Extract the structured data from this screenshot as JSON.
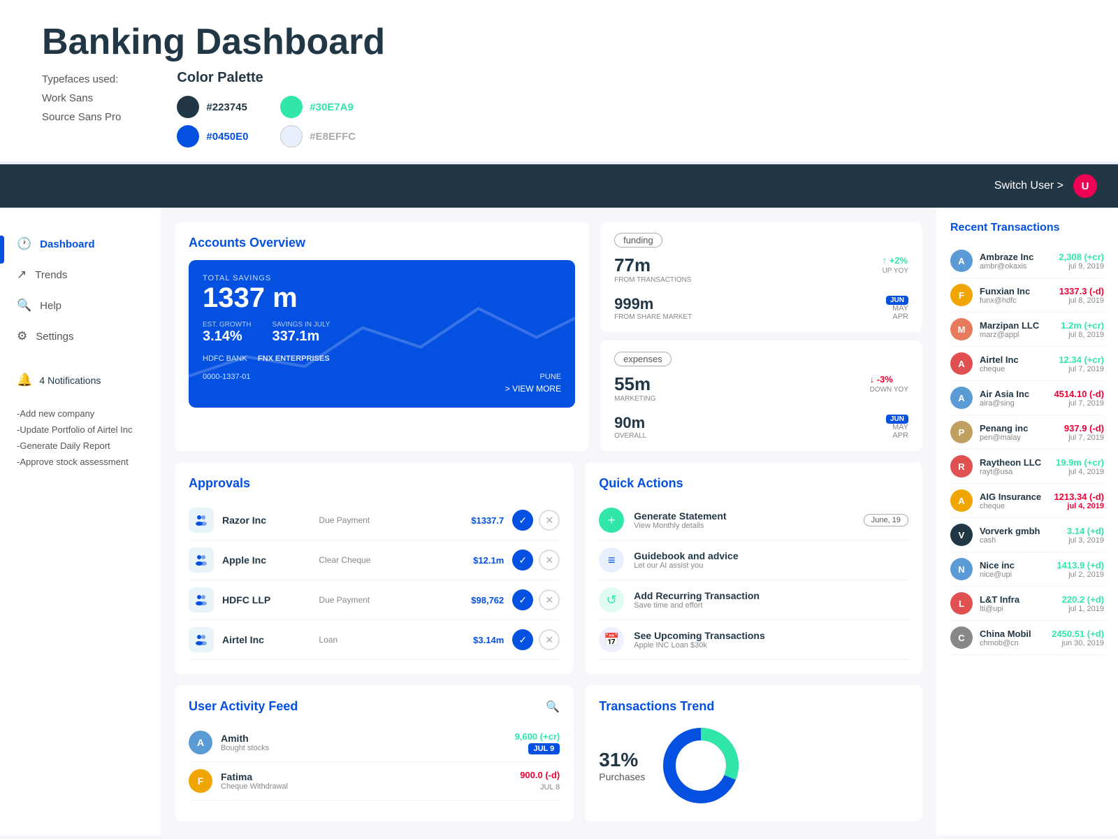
{
  "page": {
    "title": "Banking Dashboard",
    "typefaces": {
      "label": "Typefaces used:",
      "font1": "Work Sans",
      "font2": "Source Sans Pro"
    },
    "colorPalette": {
      "title": "Color Palette",
      "colors": [
        {
          "hex": "#223745",
          "dark": true
        },
        {
          "hex": "#30E7A9",
          "dark": false
        },
        {
          "hex": "#0450E0",
          "dark": false
        },
        {
          "hex": "#E8EFFC",
          "dark": false
        }
      ]
    }
  },
  "topbar": {
    "switchUser": "Switch User >",
    "avatarInitial": "U"
  },
  "sidebar": {
    "navItems": [
      {
        "label": "Dashboard",
        "icon": "🕐",
        "active": true
      },
      {
        "label": "Trends",
        "icon": "↗"
      },
      {
        "label": "Help",
        "icon": "🔍"
      },
      {
        "label": "Settings",
        "icon": "⚙"
      }
    ],
    "notifications": {
      "count": "4",
      "label": "4 Notifications"
    },
    "actions": [
      "-Add new company",
      "-Update Portfolio of Airtel Inc",
      "-Generate Daily Report",
      "-Approve stock assessment"
    ]
  },
  "accountsOverview": {
    "title": "Accounts Overview",
    "totalSavingsLabel": "TOTAL SAVINGS",
    "totalSavingsValue": "1337 m",
    "estGrowthLabel": "EST. GROWTH",
    "estGrowthValue": "3.14%",
    "savingsInJulyLabel": "SAVINGS IN JULY",
    "savingsInJulyValue": "337.1m",
    "bankName": "HDFC BANK",
    "companyName": "FNX ENTERPRISES",
    "accountNumber": "0000-1337-01",
    "location": "PUNE",
    "viewMore": "> VIEW MORE"
  },
  "funding": {
    "badge": "funding",
    "fromTransactionsLabel": "FROM TRANSACTIONS",
    "fromTransactionsValue": "77m",
    "changeLabel": "+2%",
    "changeDirection": "up",
    "upYoyLabel": "UP YOY",
    "fromShareMarketValue": "999m",
    "fromShareMarketLabel": "FROM SHARE MARKET",
    "junBadge": "JUN",
    "mayLabel": "MAY",
    "aprLabel": "APR"
  },
  "expenses": {
    "badge": "expenses",
    "marketingValue": "55m",
    "marketingLabel": "MARKETING",
    "changeLabel": "-3%",
    "changeDirection": "down",
    "downYoyLabel": "DOWN YOY",
    "overallValue": "90m",
    "overallLabel": "OVERALL",
    "junBadge": "JUN",
    "mayLabel": "MAY",
    "aprLabel": "APR"
  },
  "approvals": {
    "title": "Approvals",
    "rows": [
      {
        "company": "Razor Inc",
        "type": "Due Payment",
        "amount": "$1337.7"
      },
      {
        "company": "Apple Inc",
        "type": "Clear Cheque",
        "amount": "$12.1m"
      },
      {
        "company": "HDFC LLP",
        "type": "Due Payment",
        "amount": "$98,762"
      },
      {
        "company": "Airtel Inc",
        "type": "Loan",
        "amount": "$3.14m"
      }
    ]
  },
  "quickActions": {
    "title": "Quick Actions",
    "items": [
      {
        "icon": "+",
        "iconStyle": "green",
        "label": "Generate Statement",
        "sublabel": "View Monthly details",
        "badge": "June, 19"
      },
      {
        "icon": "≡",
        "iconStyle": "blue",
        "label": "Guidebook and advice",
        "sublabel": "Let our AI assist you",
        "badge": ""
      },
      {
        "icon": "↺",
        "iconStyle": "teal",
        "label": "Add Recurring Transaction",
        "sublabel": "Save time and effort",
        "badge": ""
      },
      {
        "icon": "📅",
        "iconStyle": "indigo",
        "label": "See Upcoming Transactions",
        "sublabel": "Apple INC   Loan   $30k",
        "badge": ""
      }
    ]
  },
  "recentTransactions": {
    "title": "Recent Transactions",
    "items": [
      {
        "initial": "A",
        "color": "#5b9bd5",
        "name": "Ambraze Inc",
        "email": "ambr@okaxis",
        "amount": "2,308 (+cr)",
        "positive": true,
        "date": "jul 9, 2019"
      },
      {
        "initial": "F",
        "color": "#f0a500",
        "name": "Funxian Inc",
        "email": "funx@hdfc",
        "amount": "1337.3 (-d)",
        "positive": false,
        "date": "jul 8, 2019"
      },
      {
        "initial": "M",
        "color": "#e87a5d",
        "name": "Marzipan LLC",
        "email": "marz@appl",
        "amount": "1.2m (+cr)",
        "positive": true,
        "date": "jul 8, 2019"
      },
      {
        "initial": "A",
        "color": "#e05050",
        "name": "Airtel Inc",
        "email": "cheque",
        "amount": "12.34 (+cr)",
        "positive": true,
        "date": "jul 7, 2019"
      },
      {
        "initial": "A",
        "color": "#5b9bd5",
        "name": "Air Asia Inc",
        "email": "aira@sing",
        "amount": "4514.10 (-d)",
        "positive": false,
        "date": "jul 7, 2019"
      },
      {
        "initial": "P",
        "color": "#c0a060",
        "name": "Penang inc",
        "email": "pen@malay",
        "amount": "937.9 (-d)",
        "positive": false,
        "date": "jul 7, 2019"
      },
      {
        "initial": "R",
        "color": "#e05050",
        "name": "Raytheon LLC",
        "email": "rayt@usa",
        "amount": "19.9m (+cr)",
        "positive": true,
        "date": "jul 4, 2019"
      },
      {
        "initial": "A",
        "color": "#f0a500",
        "name": "AIG Insurance",
        "email": "cheque",
        "amount": "1213.34 (-d)",
        "positive": false,
        "date": "jul 4, 2019",
        "dateRed": true
      },
      {
        "initial": "V",
        "color": "#223745",
        "name": "Vorverk gmbh",
        "email": "cash",
        "amount": "3.14 (+d)",
        "positive": true,
        "date": "jul 3, 2019"
      },
      {
        "initial": "N",
        "color": "#5b9bd5",
        "name": "Nice inc",
        "email": "nice@upi",
        "amount": "1413.9 (+d)",
        "positive": true,
        "date": "jul 2, 2019"
      },
      {
        "initial": "L",
        "color": "#e05050",
        "name": "L&T Infra",
        "email": "lti@upi",
        "amount": "220.2 (+d)",
        "positive": true,
        "date": "jul 1, 2019"
      },
      {
        "initial": "C",
        "color": "#888",
        "name": "China Mobil",
        "email": "chmob@cn",
        "amount": "2450.51 (+d)",
        "positive": true,
        "date": "jun 30, 2019"
      }
    ]
  },
  "userActivityFeed": {
    "title": "User Activity Feed",
    "searchIcon": "🔍",
    "items": [
      {
        "initial": "A",
        "color": "#5b9bd5",
        "name": "Amith",
        "action": "Bought stocks",
        "amount": "9,600 (+cr)",
        "positive": true,
        "date": "JUL 9",
        "dateBadge": true
      },
      {
        "initial": "F",
        "color": "#f0a500",
        "name": "Fatima",
        "action": "Cheque Withdrawal",
        "amount": "900.0 (-d)",
        "positive": false,
        "date": "JUL 8",
        "dateBadge": false
      }
    ]
  },
  "transactionsTrend": {
    "title": "Transactions Trend",
    "percent": "31%",
    "label": "Purchases",
    "donut": {
      "filled": 31,
      "total": 100,
      "colorFilled": "#30E7A9",
      "colorEmpty": "#0450E0"
    }
  }
}
